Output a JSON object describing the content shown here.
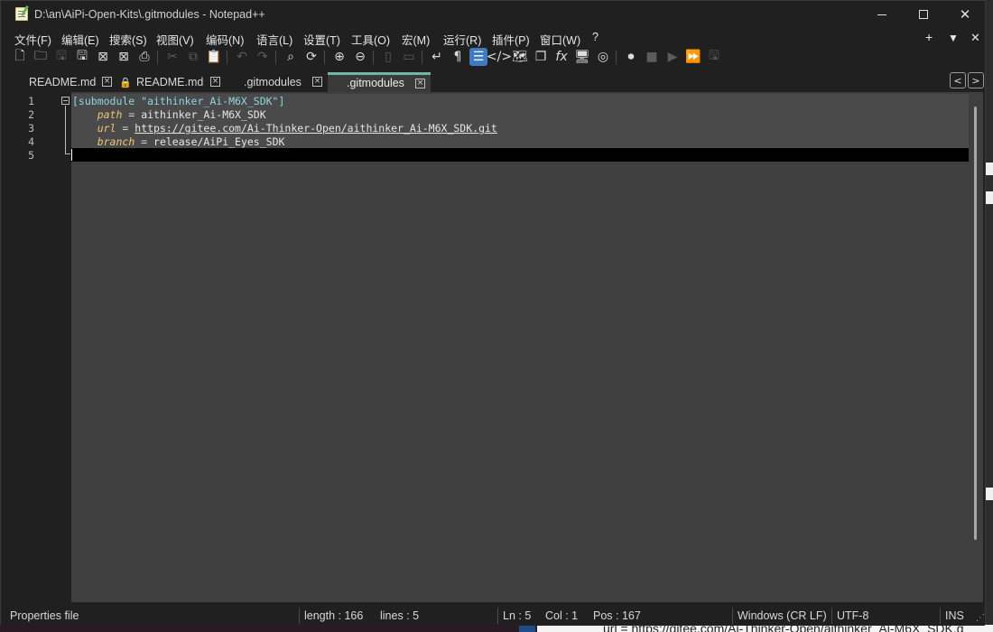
{
  "window": {
    "title": "D:\\an\\AiPi-Open-Kits\\.gitmodules - Notepad++"
  },
  "menu": {
    "items": [
      "文件(F)",
      "编辑(E)",
      "搜索(S)",
      "视图(V)",
      "编码(N)",
      "语言(L)",
      "设置(T)",
      "工具(O)",
      "宏(M)",
      "运行(R)",
      "插件(P)",
      "窗口(W)",
      "?"
    ],
    "right": [
      "+",
      "▼",
      "✕"
    ]
  },
  "toolbar": {
    "icons": [
      "new-file-icon",
      "open-file-icon",
      "save-icon",
      "save-all-icon",
      "close-icon",
      "close-all-icon",
      "print-icon",
      "cut-icon",
      "copy-icon",
      "paste-icon",
      "undo-icon",
      "redo-icon",
      "find-icon",
      "replace-icon",
      "zoom-in-icon",
      "zoom-out-icon",
      "sync-vertical-icon",
      "sync-horizontal-icon",
      "word-wrap-icon",
      "show-all-chars-icon",
      "indent-guide-icon",
      "xml-tag-icon",
      "document-map-icon",
      "document-list-icon",
      "function-list-icon",
      "folder-workspace-icon",
      "monitoring-icon",
      "record-macro-icon",
      "stop-record-icon",
      "play-macro-icon",
      "run-macro-multiple-icon",
      "save-macro-icon"
    ]
  },
  "tabs": [
    {
      "label": "README.md",
      "active": false,
      "locked": false
    },
    {
      "label": "README.md",
      "active": false,
      "locked": true
    },
    {
      "label": ".gitmodules",
      "active": false,
      "locked": false
    },
    {
      "label": ".gitmodules",
      "active": true,
      "locked": false
    }
  ],
  "tab_nav": {
    "prev": "<",
    "next": ">"
  },
  "editor": {
    "line_numbers": [
      "1",
      "2",
      "3",
      "4",
      "5"
    ],
    "lines": [
      {
        "section": "[submodule \"aithinker_Ai-M6X_SDK\"]"
      },
      {
        "indent": "    ",
        "key": "path",
        "eq": " = ",
        "value": "aithinker_Ai-M6X_SDK"
      },
      {
        "indent": "    ",
        "key": "url",
        "eq": " = ",
        "link": "https://gitee.com/Ai-Thinker-Open/aithinker_Ai-M6X_SDK.git"
      },
      {
        "indent": "    ",
        "key": "branch",
        "eq": " = ",
        "value": "release/AiPi_Eyes_SDK"
      },
      {}
    ]
  },
  "status": {
    "file_type": "Properties file",
    "length": "length : 166",
    "lines": "lines : 5",
    "ln": "Ln : 5",
    "col": "Col : 1",
    "pos": "Pos : 167",
    "eol": "Windows (CR LF)",
    "encoding": "UTF-8",
    "mode": "INS"
  },
  "background": {
    "peek_text": "url = https://gitee.com/Ai-Thinker-Open/aithinker_Ai-M6X_SDK.g"
  }
}
